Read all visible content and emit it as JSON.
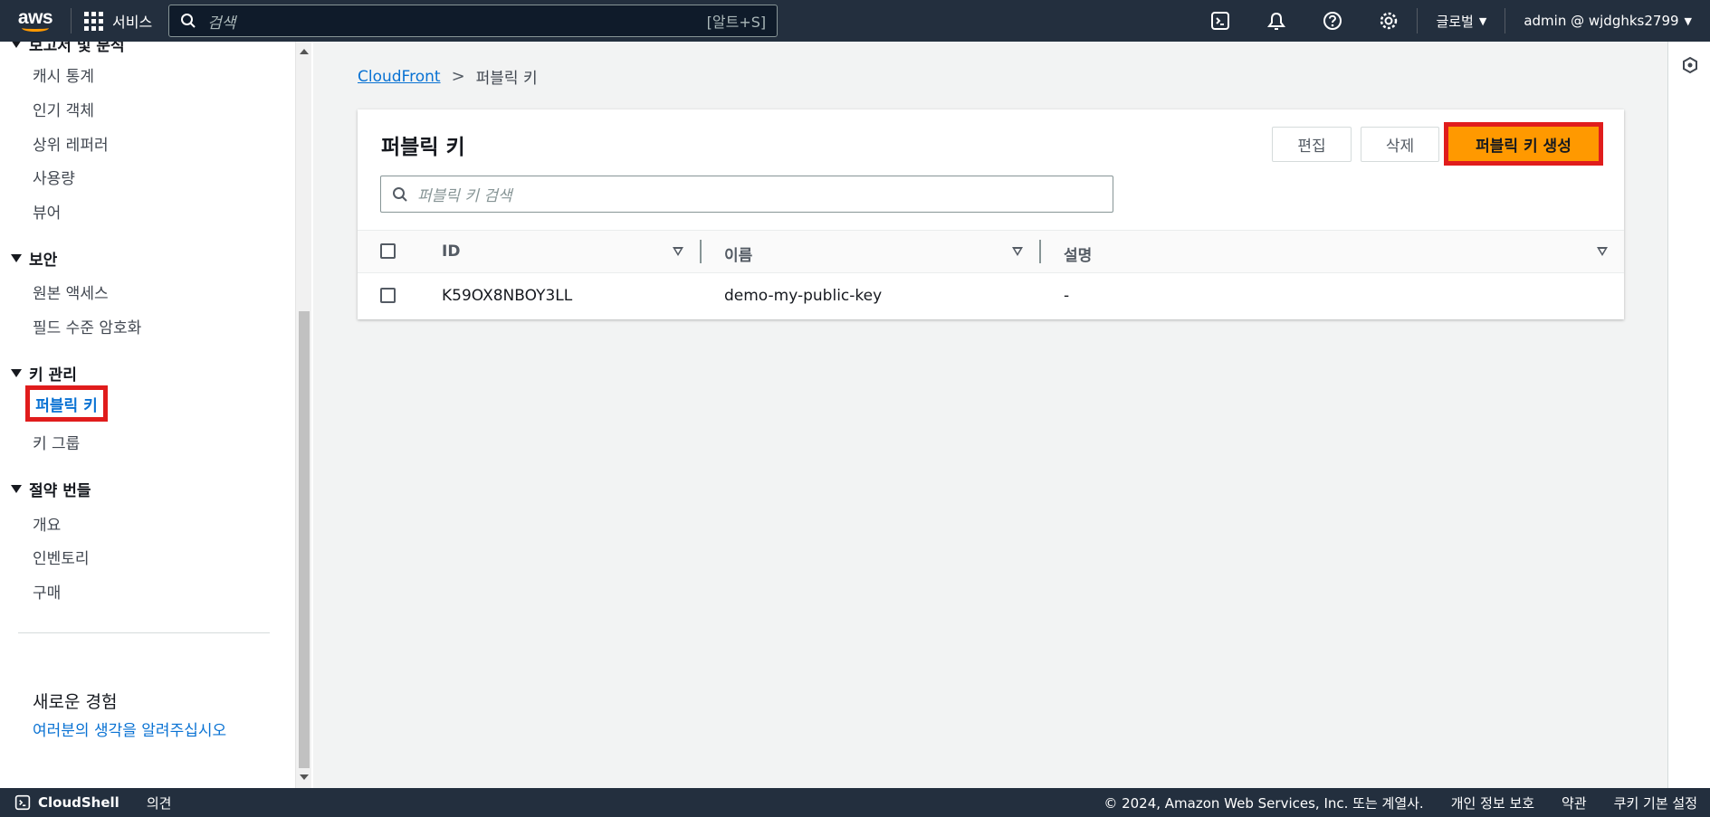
{
  "topnav": {
    "logo_text": "aws",
    "services_label": "서비스",
    "search_placeholder": "검색",
    "search_hint": "[알트+S]",
    "region_label": "글로벌",
    "account_label": "admin @ wjdghks2799"
  },
  "sidebar": {
    "partial_header": "보고서 및 분석",
    "reports_items": [
      "캐시 통계",
      "인기 객체",
      "상위 레퍼러",
      "사용량",
      "뷰어"
    ],
    "security_section": "보안",
    "security_items": [
      "원본 액세스",
      "필드 수준 암호화"
    ],
    "keys_section": "키 관리",
    "keys_active_item": "퍼블릭 키",
    "keys_items": [
      "키 그룹"
    ],
    "savings_section": "절약 번들",
    "savings_items": [
      "개요",
      "인벤토리",
      "구매"
    ],
    "new_experience_title": "새로운 경험",
    "feedback_link": "여러분의 생각을 알려주십시오"
  },
  "breadcrumb": {
    "root": "CloudFront",
    "current": "퍼블릭 키"
  },
  "panel": {
    "title": "퍼블릭 키",
    "edit_button": "편집",
    "delete_button": "삭제",
    "create_button": "퍼블릭 키 생성",
    "search_placeholder": "퍼블릭 키 검색",
    "columns": [
      "ID",
      "이름",
      "설명"
    ],
    "rows": [
      {
        "id": "K59OX8NBOY3LL",
        "name": "demo-my-public-key",
        "description": "-"
      }
    ]
  },
  "footer": {
    "cloudshell": "CloudShell",
    "feedback": "의견",
    "copyright": "© 2024, Amazon Web Services, Inc. 또는 계열사.",
    "privacy": "개인 정보 보호",
    "terms": "약관",
    "cookies": "쿠키 기본 설정"
  }
}
